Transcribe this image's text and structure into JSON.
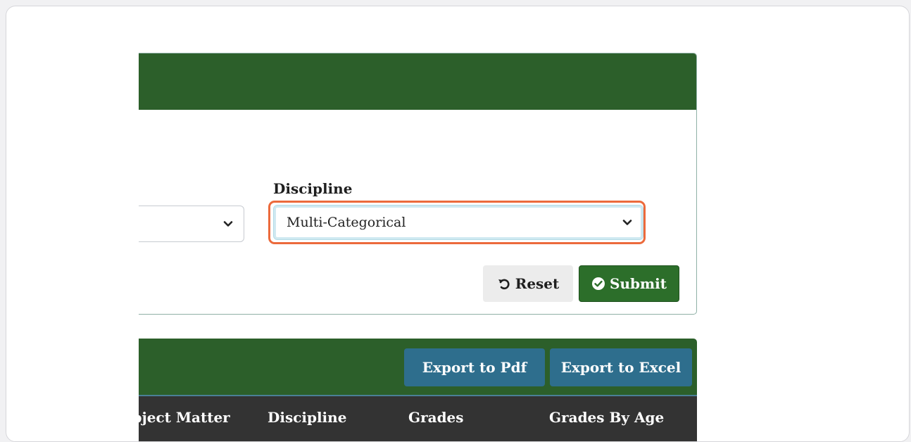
{
  "filter_form": {
    "discipline_label": "Discipline",
    "discipline_value": "Multi-Categorical",
    "reset_label": "Reset",
    "submit_label": "Submit"
  },
  "results": {
    "export_pdf_label": "Export to Pdf",
    "export_excel_label": "Export to Excel",
    "columns": [
      "ubject Matter",
      "Discipline",
      "Grades",
      "Grades By Age"
    ]
  },
  "colors": {
    "brand_green": "#2c5f2a",
    "submit_green": "#2c6e2a",
    "export_blue": "#2e6e8d",
    "focus_orange": "#ec6a3c",
    "table_header": "#333333"
  }
}
